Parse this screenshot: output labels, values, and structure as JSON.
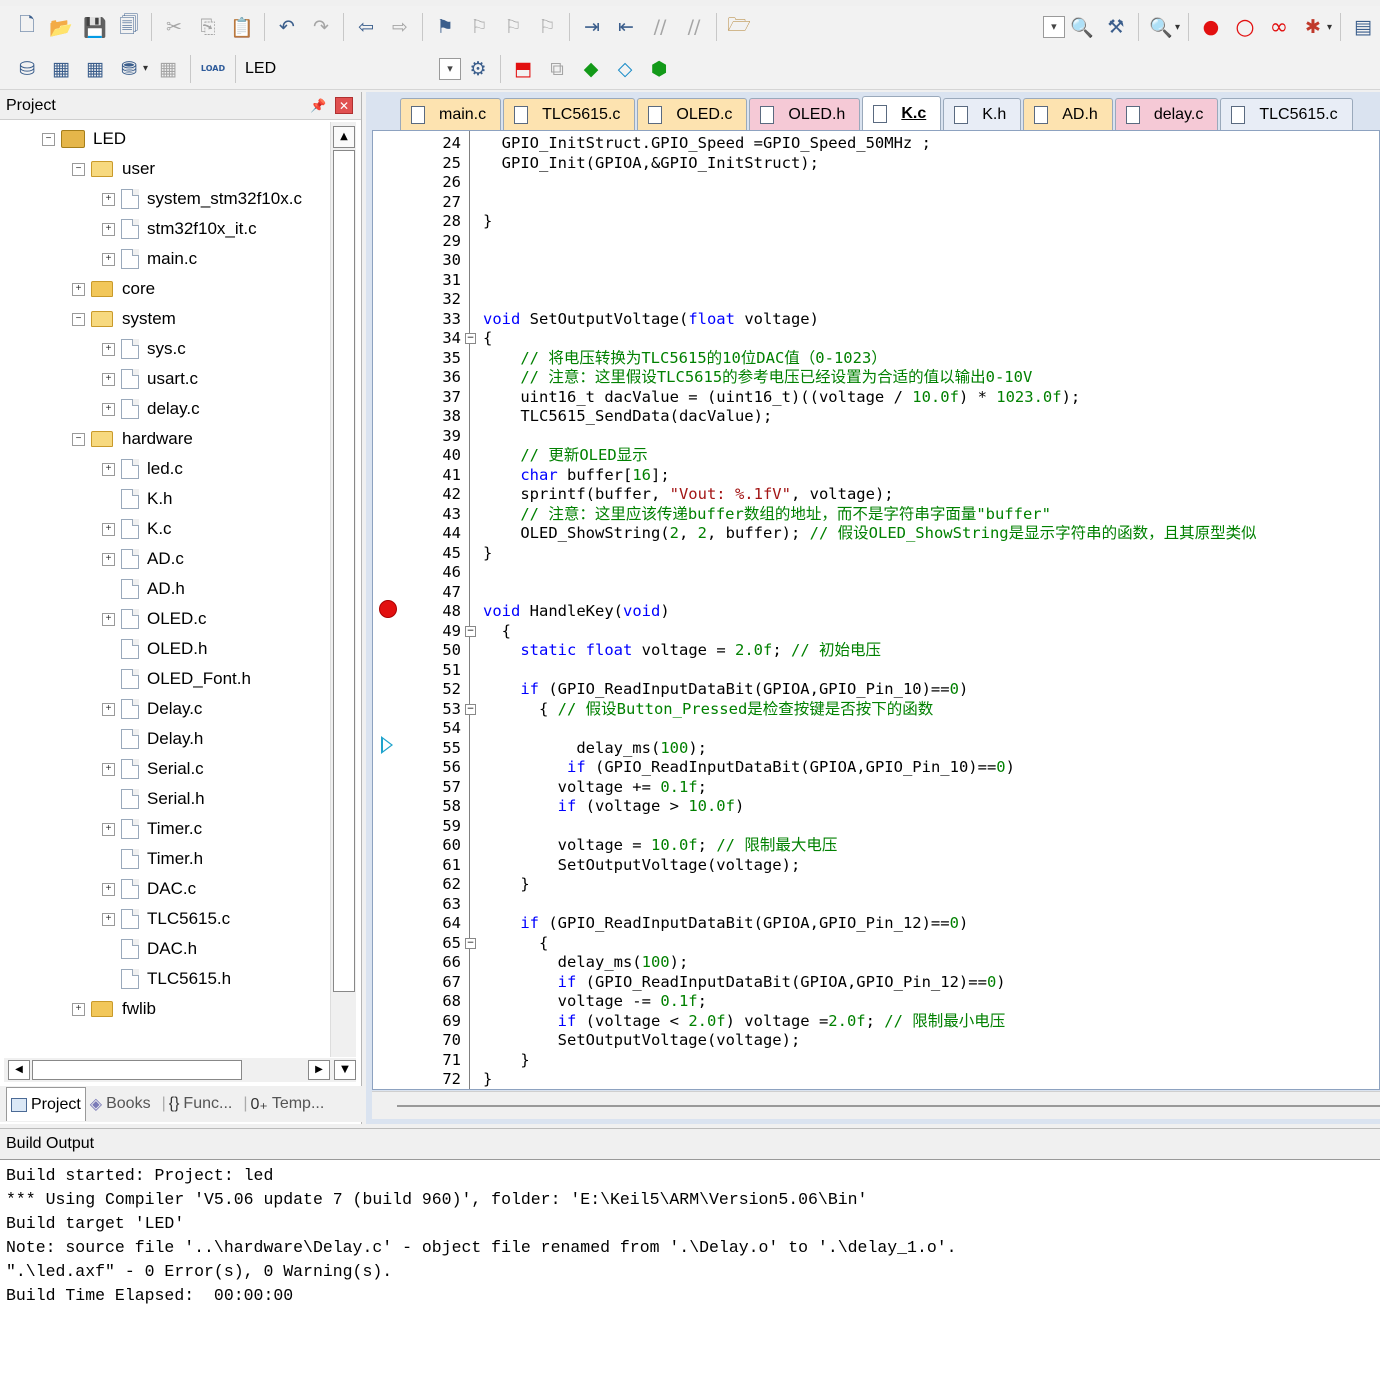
{
  "toolbar1": {
    "icons": [
      "new-file-icon",
      "open-file-icon",
      "save-icon",
      "save-all-icon",
      "cut-icon",
      "copy-icon",
      "paste-icon",
      "undo-icon",
      "redo-icon",
      "nav-back-icon",
      "nav-forward-icon",
      "bookmark-icon",
      "bookmark-prev-icon",
      "bookmark-next-icon",
      "bookmark-clear-icon",
      "indent-icon",
      "unindent-icon",
      "comment-icon",
      "uncomment-icon",
      "find-in-files-icon"
    ],
    "right_icons": [
      "find-dropdown-icon",
      "incremental-find-icon",
      "debug-start-icon",
      "breakpoint-insert-icon",
      "breakpoint-disable-icon",
      "breakpoint-kill-icon",
      "window-icon"
    ]
  },
  "toolbar2": {
    "target_label": "LED",
    "load_label": "LOAD"
  },
  "project_panel": {
    "title": "Project",
    "tree": [
      {
        "label": "LED",
        "depth": 0,
        "type": "project",
        "expander": "−"
      },
      {
        "label": "user",
        "depth": 1,
        "type": "folder-open",
        "expander": "−"
      },
      {
        "label": "system_stm32f10x.c",
        "depth": 2,
        "type": "file",
        "expander": "+"
      },
      {
        "label": "stm32f10x_it.c",
        "depth": 2,
        "type": "file",
        "expander": "+"
      },
      {
        "label": "main.c",
        "depth": 2,
        "type": "file",
        "expander": "+"
      },
      {
        "label": "core",
        "depth": 1,
        "type": "folder",
        "expander": "+"
      },
      {
        "label": "system",
        "depth": 1,
        "type": "folder-open",
        "expander": "−"
      },
      {
        "label": "sys.c",
        "depth": 2,
        "type": "file",
        "expander": "+"
      },
      {
        "label": "usart.c",
        "depth": 2,
        "type": "file",
        "expander": "+"
      },
      {
        "label": "delay.c",
        "depth": 2,
        "type": "file",
        "expander": "+"
      },
      {
        "label": "hardware",
        "depth": 1,
        "type": "folder-open",
        "expander": "−"
      },
      {
        "label": "led.c",
        "depth": 2,
        "type": "file",
        "expander": "+"
      },
      {
        "label": "K.h",
        "depth": 2,
        "type": "file",
        "expander": ""
      },
      {
        "label": "K.c",
        "depth": 2,
        "type": "file",
        "expander": "+"
      },
      {
        "label": "AD.c",
        "depth": 2,
        "type": "file",
        "expander": "+"
      },
      {
        "label": "AD.h",
        "depth": 2,
        "type": "file",
        "expander": ""
      },
      {
        "label": "OLED.c",
        "depth": 2,
        "type": "file",
        "expander": "+"
      },
      {
        "label": "OLED.h",
        "depth": 2,
        "type": "file",
        "expander": ""
      },
      {
        "label": "OLED_Font.h",
        "depth": 2,
        "type": "file",
        "expander": ""
      },
      {
        "label": "Delay.c",
        "depth": 2,
        "type": "file",
        "expander": "+"
      },
      {
        "label": "Delay.h",
        "depth": 2,
        "type": "file",
        "expander": ""
      },
      {
        "label": "Serial.c",
        "depth": 2,
        "type": "file",
        "expander": "+"
      },
      {
        "label": "Serial.h",
        "depth": 2,
        "type": "file",
        "expander": ""
      },
      {
        "label": "Timer.c",
        "depth": 2,
        "type": "file",
        "expander": "+"
      },
      {
        "label": "Timer.h",
        "depth": 2,
        "type": "file",
        "expander": ""
      },
      {
        "label": "DAC.c",
        "depth": 2,
        "type": "file",
        "expander": "+"
      },
      {
        "label": "TLC5615.c",
        "depth": 2,
        "type": "file",
        "expander": "+"
      },
      {
        "label": "DAC.h",
        "depth": 2,
        "type": "file",
        "expander": ""
      },
      {
        "label": "TLC5615.h",
        "depth": 2,
        "type": "file",
        "expander": ""
      },
      {
        "label": "fwlib",
        "depth": 1,
        "type": "folder",
        "expander": "+"
      }
    ],
    "tabs": [
      {
        "label": "Project",
        "active": true
      },
      {
        "label": "Books",
        "active": false
      },
      {
        "label": "Func...",
        "active": false
      },
      {
        "label": "Temp...",
        "active": false
      }
    ]
  },
  "editor": {
    "tabs": [
      {
        "label": "main.c",
        "kind": "c"
      },
      {
        "label": "TLC5615.c",
        "kind": "c"
      },
      {
        "label": "OLED.c",
        "kind": "c"
      },
      {
        "label": "OLED.h",
        "kind": "h"
      },
      {
        "label": "K.c",
        "kind": "active"
      },
      {
        "label": "K.h",
        "kind": "plain"
      },
      {
        "label": "AD.h",
        "kind": "c"
      },
      {
        "label": "delay.c",
        "kind": "h"
      },
      {
        "label": "TLC5615.c",
        "kind": "plain"
      }
    ],
    "breakpoint_line": "48",
    "current_line": "55",
    "lines": [
      {
        "n": "24",
        "t": "  GPIO_InitStruct.GPIO_Speed =GPIO_Speed_50MHz ;"
      },
      {
        "n": "25",
        "t": "  GPIO_Init(GPIOA,&GPIO_InitStruct);"
      },
      {
        "n": "26",
        "t": ""
      },
      {
        "n": "27",
        "t": ""
      },
      {
        "n": "28",
        "t": "}"
      },
      {
        "n": "29",
        "t": ""
      },
      {
        "n": "30",
        "t": ""
      },
      {
        "n": "31",
        "t": ""
      },
      {
        "n": "32",
        "t": ""
      },
      {
        "n": "33",
        "t": "void SetOutputVoltage(float voltage)"
      },
      {
        "n": "34",
        "t": "{"
      },
      {
        "n": "35",
        "t": "    // 将电压转换为TLC5615的10位DAC值（0-1023）"
      },
      {
        "n": "36",
        "t": "    // 注意：这里假设TLC5615的参考电压已经设置为合适的值以输出0-10V"
      },
      {
        "n": "37",
        "t": "    uint16_t dacValue = (uint16_t)((voltage / 10.0f) * 1023.0f);"
      },
      {
        "n": "38",
        "t": "    TLC5615_SendData(dacValue);"
      },
      {
        "n": "39",
        "t": ""
      },
      {
        "n": "40",
        "t": "    // 更新OLED显示"
      },
      {
        "n": "41",
        "t": "    char buffer[16];"
      },
      {
        "n": "42",
        "t": "    sprintf(buffer, \"Vout: %.1fV\", voltage);"
      },
      {
        "n": "43",
        "t": "    // 注意：这里应该传递buffer数组的地址，而不是字符串字面量\"buffer\""
      },
      {
        "n": "44",
        "t": "    OLED_ShowString(2, 2, buffer); // 假设OLED_ShowString是显示字符串的函数，且其原型类似"
      },
      {
        "n": "45",
        "t": "}"
      },
      {
        "n": "46",
        "t": ""
      },
      {
        "n": "47",
        "t": ""
      },
      {
        "n": "48",
        "t": "void HandleKey(void)"
      },
      {
        "n": "49",
        "t": "  {"
      },
      {
        "n": "50",
        "t": "    static float voltage = 2.0f; // 初始电压"
      },
      {
        "n": "51",
        "t": ""
      },
      {
        "n": "52",
        "t": "    if (GPIO_ReadInputDataBit(GPIOA,GPIO_Pin_10)==0)"
      },
      {
        "n": "53",
        "t": "      { // 假设Button_Pressed是检查按键是否按下的函数"
      },
      {
        "n": "54",
        "t": ""
      },
      {
        "n": "55",
        "t": "          delay_ms(100);"
      },
      {
        "n": "56",
        "t": "         if (GPIO_ReadInputDataBit(GPIOA,GPIO_Pin_10)==0)"
      },
      {
        "n": "57",
        "t": "        voltage += 0.1f;"
      },
      {
        "n": "58",
        "t": "        if (voltage > 10.0f)"
      },
      {
        "n": "59",
        "t": ""
      },
      {
        "n": "60",
        "t": "        voltage = 10.0f; // 限制最大电压"
      },
      {
        "n": "61",
        "t": "        SetOutputVoltage(voltage);"
      },
      {
        "n": "62",
        "t": "    }"
      },
      {
        "n": "63",
        "t": ""
      },
      {
        "n": "64",
        "t": "    if (GPIO_ReadInputDataBit(GPIOA,GPIO_Pin_12)==0)"
      },
      {
        "n": "65",
        "t": "      {"
      },
      {
        "n": "66",
        "t": "        delay_ms(100);"
      },
      {
        "n": "67",
        "t": "        if (GPIO_ReadInputDataBit(GPIOA,GPIO_Pin_12)==0)"
      },
      {
        "n": "68",
        "t": "        voltage -= 0.1f;"
      },
      {
        "n": "69",
        "t": "        if (voltage < 2.0f) voltage =2.0f; // 限制最小电压"
      },
      {
        "n": "70",
        "t": "        SetOutputVoltage(voltage);"
      },
      {
        "n": "71",
        "t": "    }"
      },
      {
        "n": "72",
        "t": "}"
      }
    ]
  },
  "build_output": {
    "title": "Build Output",
    "lines": [
      "Build started: Project: led",
      "*** Using Compiler 'V5.06 update 7 (build 960)', folder: 'E:\\Keil5\\ARM\\Version5.06\\Bin'",
      "Build target 'LED'",
      "Note: source file '..\\hardware\\Delay.c' - object file renamed from '.\\Delay.o' to '.\\delay_1.o'.",
      "\".\\led.axf\" - 0 Error(s), 0 Warning(s).",
      "Build Time Elapsed:  00:00:00"
    ]
  },
  "colors": {
    "keyword": "#0000ff",
    "number": "#008000",
    "comment": "#008000",
    "breakpoint": "#e21010",
    "tab_c": "#fde3b0",
    "tab_h": "#f5c9d6"
  }
}
